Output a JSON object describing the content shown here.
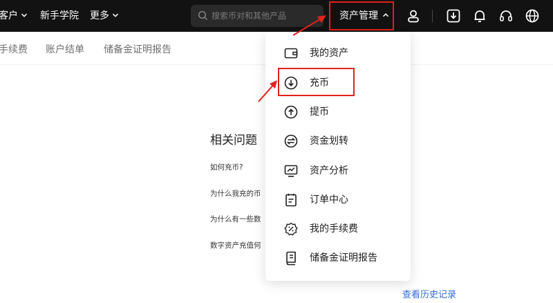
{
  "nav": {
    "customer_label": "客户",
    "academy_label": "新手学院",
    "more_label": "更多",
    "search_placeholder": "搜索币对和其他产品",
    "asset_management_label": "资产管理"
  },
  "subnav": {
    "tabs": [
      "手续费",
      "账户结单",
      "储备金证明报告"
    ]
  },
  "faq": {
    "title": "相关问题",
    "questions": [
      "如何充币?",
      "为什么我充的币",
      "为什么有一些数",
      "数字资产充值何"
    ]
  },
  "history_link": "查看历史记录",
  "dropdown": {
    "items": [
      {
        "label": "我的资产",
        "icon": "wallet-icon"
      },
      {
        "label": "充币",
        "icon": "deposit-icon"
      },
      {
        "label": "提币",
        "icon": "withdraw-icon"
      },
      {
        "label": "资金划转",
        "icon": "transfer-icon"
      },
      {
        "label": "资产分析",
        "icon": "analysis-icon"
      },
      {
        "label": "订单中心",
        "icon": "orders-icon"
      },
      {
        "label": "我的手续费",
        "icon": "fee-icon"
      },
      {
        "label": "储备金证明报告",
        "icon": "reserve-report-icon"
      }
    ]
  },
  "colors": {
    "highlight": "#e1221b",
    "topbar": "#121212",
    "link": "#2f6bd8"
  }
}
